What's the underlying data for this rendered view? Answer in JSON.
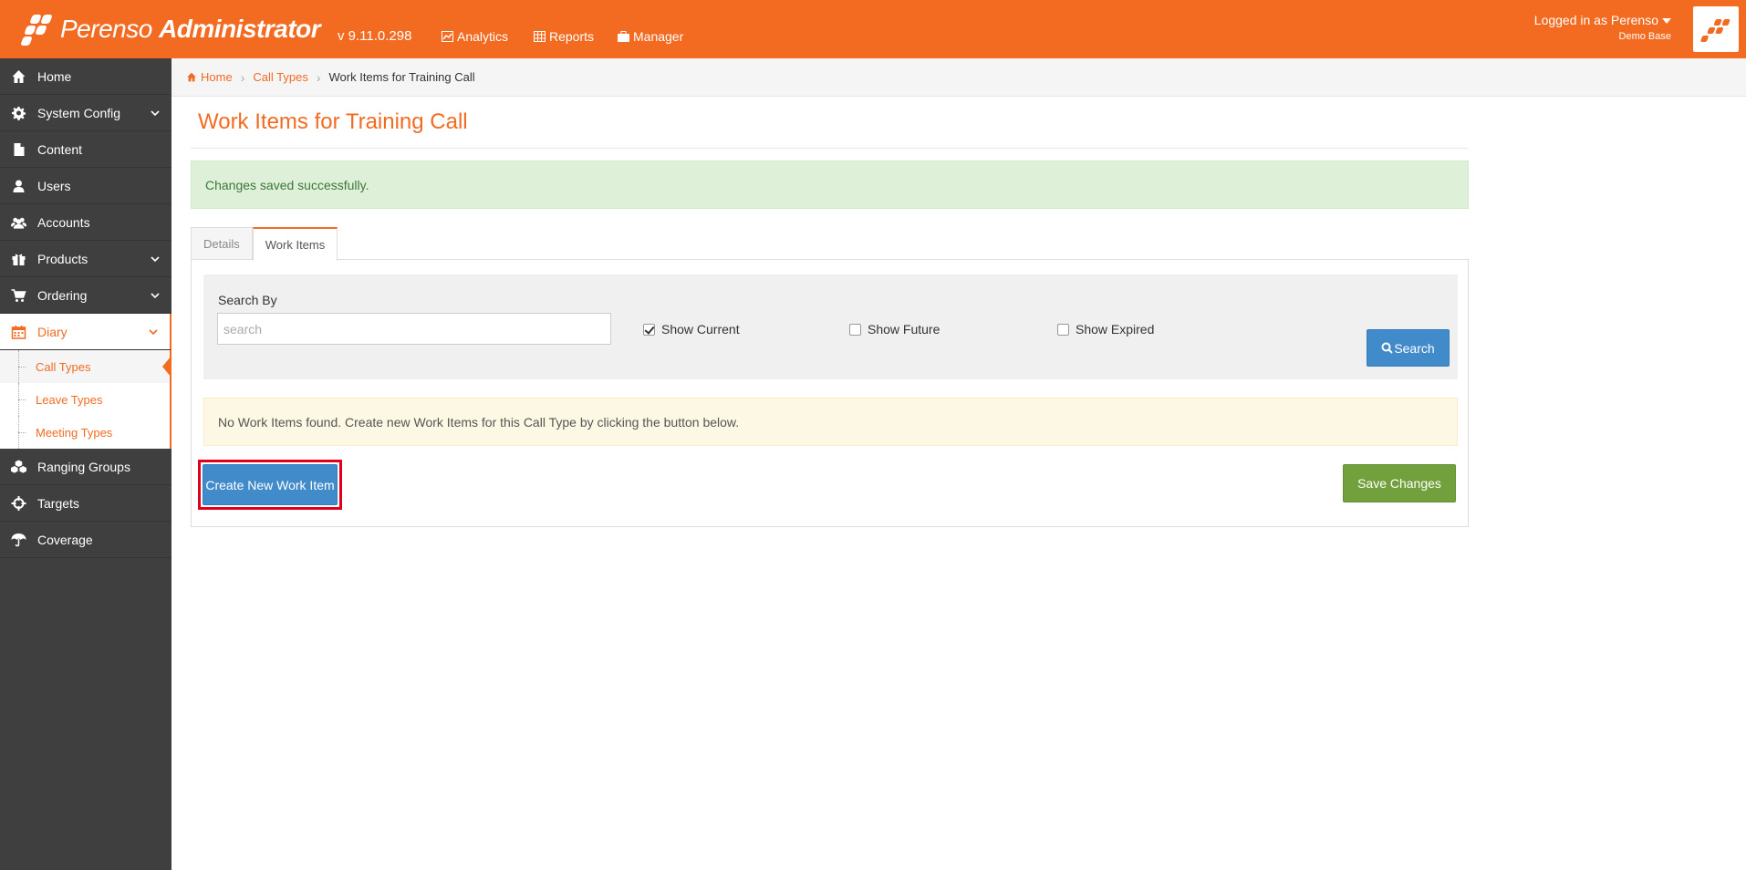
{
  "colors": {
    "brand": "#f26b21",
    "sidebar": "#3f3f3f",
    "primary": "#428bca",
    "success": "#72a03d"
  },
  "header": {
    "logo_name": "Perenso",
    "logo_suffix": "Administrator",
    "version": "v 9.11.0.298",
    "nav": [
      {
        "label": "Analytics",
        "icon": "chart-icon"
      },
      {
        "label": "Reports",
        "icon": "table-icon"
      },
      {
        "label": "Manager",
        "icon": "briefcase-icon"
      }
    ],
    "user_label": "Logged in as Perenso",
    "user_base": "Demo Base"
  },
  "sidebar": {
    "items": [
      {
        "label": "Home",
        "icon": "home-icon"
      },
      {
        "label": "System Config",
        "icon": "gear-icon",
        "expandable": true
      },
      {
        "label": "Content",
        "icon": "file-icon"
      },
      {
        "label": "Users",
        "icon": "user-icon"
      },
      {
        "label": "Accounts",
        "icon": "users-icon"
      },
      {
        "label": "Products",
        "icon": "gift-icon",
        "expandable": true
      },
      {
        "label": "Ordering",
        "icon": "cart-icon",
        "expandable": true
      },
      {
        "label": "Diary",
        "icon": "calendar-icon",
        "expandable": true,
        "active": true
      },
      {
        "label": "Ranging Groups",
        "icon": "cubes-icon"
      },
      {
        "label": "Targets",
        "icon": "crosshairs-icon"
      },
      {
        "label": "Coverage",
        "icon": "umbrella-icon"
      }
    ],
    "diary_subitems": [
      {
        "label": "Call Types",
        "current": true
      },
      {
        "label": "Leave Types"
      },
      {
        "label": "Meeting Types"
      }
    ]
  },
  "breadcrumb": {
    "home": "Home",
    "call_types": "Call Types",
    "current": "Work Items for Training Call"
  },
  "page": {
    "title": "Work Items for Training Call",
    "success_message": "Changes saved successfully.",
    "tabs": [
      {
        "label": "Details",
        "active": false
      },
      {
        "label": "Work Items",
        "active": true
      }
    ]
  },
  "search": {
    "label": "Search By",
    "placeholder": "search",
    "value": "",
    "show_current": "Show Current",
    "show_current_checked": true,
    "show_future": "Show Future",
    "show_future_checked": false,
    "show_expired": "Show Expired",
    "show_expired_checked": false,
    "button": "Search"
  },
  "empty_message": "No Work Items found. Create new Work Items for this Call Type by clicking the button below.",
  "buttons": {
    "create": "Create New Work Item",
    "save": "Save Changes"
  }
}
